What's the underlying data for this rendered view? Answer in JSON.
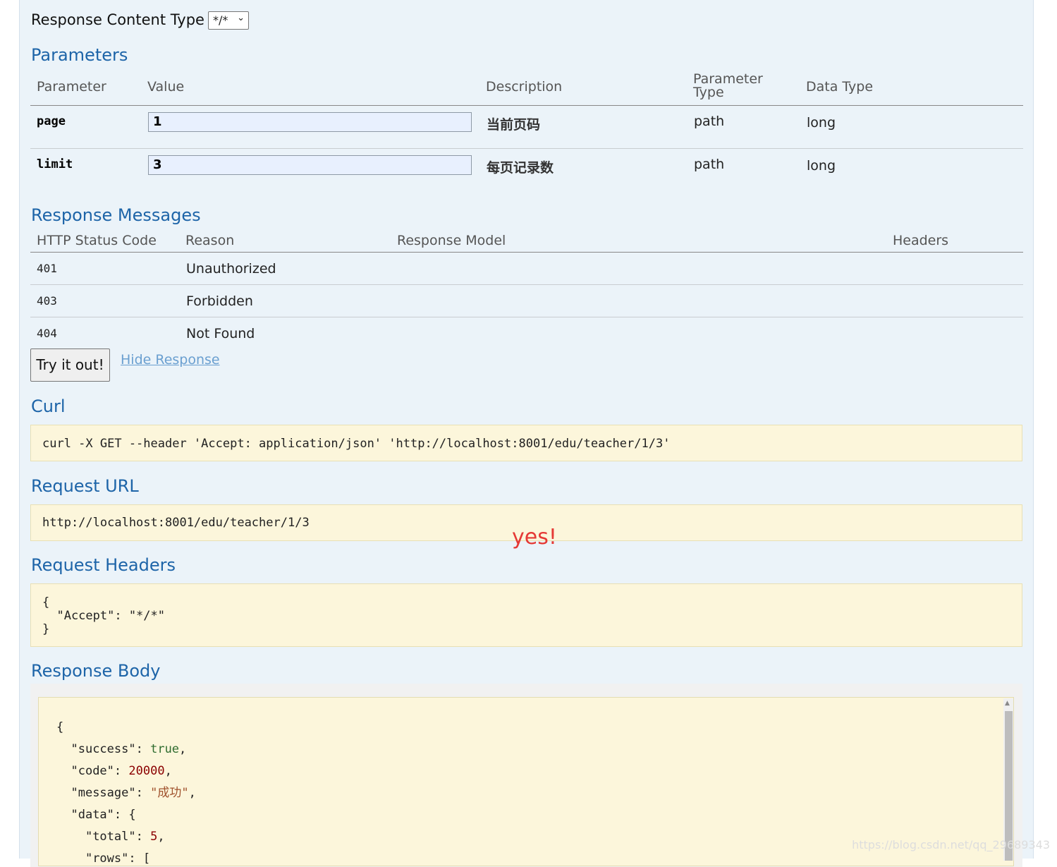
{
  "response_content_type": {
    "label": "Response Content Type",
    "value": "*/*"
  },
  "parameters": {
    "title": "Parameters",
    "headers": {
      "parameter": "Parameter",
      "value": "Value",
      "description": "Description",
      "parameter_type_1": "Parameter",
      "parameter_type_2": "Type",
      "data_type": "Data Type"
    },
    "rows": [
      {
        "name": "page",
        "value": "1",
        "description": "当前页码",
        "type": "path",
        "data_type": "long"
      },
      {
        "name": "limit",
        "value": "3",
        "description": "每页记录数",
        "type": "path",
        "data_type": "long"
      }
    ]
  },
  "response_messages": {
    "title": "Response Messages",
    "headers": {
      "status": "HTTP Status Code",
      "reason": "Reason",
      "model": "Response Model",
      "headers": "Headers"
    },
    "rows": [
      {
        "code": "401",
        "reason": "Unauthorized"
      },
      {
        "code": "403",
        "reason": "Forbidden"
      },
      {
        "code": "404",
        "reason": "Not Found"
      }
    ]
  },
  "actions": {
    "try_label": "Try it out!",
    "hide_label": "Hide Response"
  },
  "curl": {
    "title": "Curl",
    "command": "curl -X GET --header 'Accept: application/json' 'http://localhost:8001/edu/teacher/1/3'"
  },
  "request_url": {
    "title": "Request URL",
    "url": "http://localhost:8001/edu/teacher/1/3"
  },
  "annotation": "yes!",
  "request_headers": {
    "title": "Request Headers",
    "line1": "{",
    "line2": "  \"Accept\": \"*/*\"",
    "line3": "}"
  },
  "response_body": {
    "title": "Response Body",
    "open": "{",
    "success_key": "\"success\"",
    "success_val": "true",
    "code_key": "\"code\"",
    "code_val": "20000",
    "message_key": "\"message\"",
    "message_val": "\"成功\"",
    "data_key": "\"data\"",
    "data_open": "{",
    "total_key": "\"total\"",
    "total_val": "5",
    "rows_key": "\"rows\"",
    "rows_open": "["
  },
  "watermark": "https://blog.csdn.net/qq_29689343",
  "colors": {
    "panel_bg": "#ebf3f9",
    "heading": "#1d64a8",
    "code_bg": "#fcf6db",
    "annotation": "#e53935"
  }
}
